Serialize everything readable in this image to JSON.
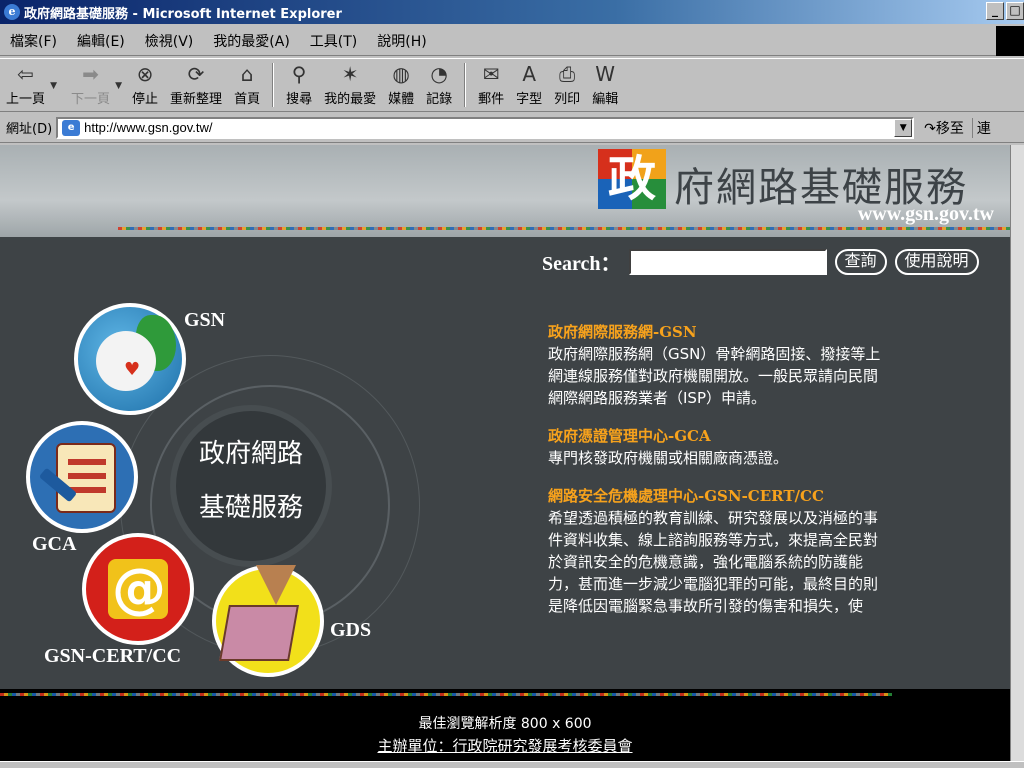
{
  "window": {
    "title": "政府網路基礎服務 - Microsoft Internet Explorer",
    "icon": "ie-icon",
    "minimize": "_",
    "maximize": "□"
  },
  "menu": [
    "檔案(F)",
    "編輯(E)",
    "檢視(V)",
    "我的最愛(A)",
    "工具(T)",
    "說明(H)"
  ],
  "toolbar": {
    "back": "上一頁",
    "forward": "下一頁",
    "stop": "停止",
    "refresh": "重新整理",
    "home": "首頁",
    "search": "搜尋",
    "favorites": "我的最愛",
    "media": "媒體",
    "history": "記錄",
    "mail": "郵件",
    "font": "字型",
    "print": "列印",
    "edit": "編輯"
  },
  "address": {
    "label": "網址(D)",
    "url": "http://www.gsn.gov.tw/",
    "go": "移至",
    "links": "連"
  },
  "header": {
    "logo_char": "政",
    "title": "府網路基礎服務",
    "site_url": "www.gsn.gov.tw"
  },
  "search": {
    "label": "Search：",
    "value": "",
    "query_button": "查詢",
    "help_button": "使用說明"
  },
  "graphic": {
    "center_line1": "政府網路",
    "center_line2": "基礎服務",
    "labels": {
      "gsn": "GSN",
      "gca": "GCA",
      "cert": "GSN-CERT/CC",
      "gds": "GDS"
    }
  },
  "sections": [
    {
      "title": "政府網際服務網-GSN",
      "body": "政府網際服務網（GSN）骨幹網路固接、撥接等上網連線服務僅對政府機關開放。一般民眾請向民間網際網路服務業者（ISP）申請。"
    },
    {
      "title": "政府憑證管理中心-GCA",
      "body": "專門核發政府機關或相關廠商憑證。"
    },
    {
      "title": "網路安全危機處理中心-GSN-CERT/CC",
      "body": "希望透過積極的教育訓練、研究發展以及消極的事件資料收集、線上諮詢服務等方式，來提高全民對於資訊安全的危機意識，強化電腦系統的防護能力，甚而進一步減少電腦犯罪的可能，最終目的則是降低因電腦緊急事故所引發的傷害和損失，使"
    }
  ],
  "footer": {
    "resolution": "最佳瀏覽解析度 800 x 600",
    "organizer": "主辦單位：行政院研究發展考核委員會"
  }
}
